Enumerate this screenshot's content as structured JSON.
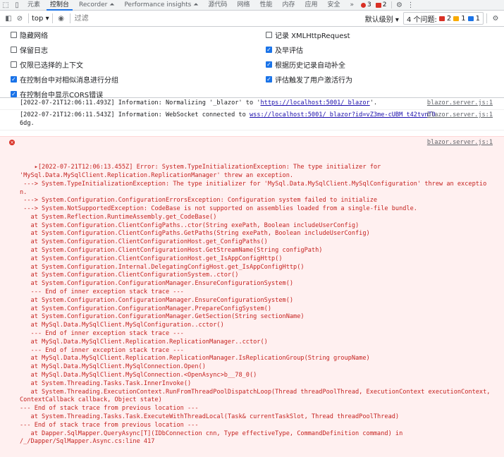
{
  "tabs": [
    "元素",
    "控制台",
    "Recorder ⏶",
    "Performance insights ⏶",
    "源代码",
    "网络",
    "性能",
    "内存",
    "应用",
    "安全"
  ],
  "active_tab_index": 1,
  "more_tabs": "»",
  "error_count": "3",
  "warning_count": "2",
  "toolbar": {
    "context": "top ▾",
    "filter_placeholder": "过滤",
    "level": "默认级别 ▾",
    "issues_label": "4 个问题:",
    "issues_errors": "2",
    "issues_warnings": "1",
    "issues_info": "1"
  },
  "settings": {
    "left": [
      {
        "label": "隐藏网络",
        "checked": false
      },
      {
        "label": "保留日志",
        "checked": false
      },
      {
        "label": "仅限已选择的上下文",
        "checked": false
      },
      {
        "label": "在控制台中对相似消息进行分组",
        "checked": true
      },
      {
        "label": "在控制台中显示CORS错误",
        "checked": true
      }
    ],
    "right": [
      {
        "label": "记录 XMLHttpRequest",
        "checked": false
      },
      {
        "label": "及早评估",
        "checked": true
      },
      {
        "label": "根据历史记录自动补全",
        "checked": true
      },
      {
        "label": "评估触发了用户激活行为",
        "checked": true
      }
    ]
  },
  "messages": [
    {
      "prefix": "[2022-07-21T12:06:11.493Z] Information: Normalizing '_blazor' to '",
      "link": "https://localhost:5001/_blazor",
      "suffix": "'.",
      "source": "blazor.server.js:1"
    },
    {
      "prefix": "[2022-07-21T12:06:11.543Z] Information: WebSocket connected to ",
      "link": "wss://localhost:5001/_blazor?id=vZ3me-cUBM_t42tvnT0",
      "suffix": "",
      "cont": "6dg.",
      "source": "blazor.server.js:1"
    }
  ],
  "error": {
    "source": "blazor.server.js:1",
    "text": "▸[2022-07-21T12:06:13.455Z] Error: System.TypeInitializationException: The type initializer for\n'MySql.Data.MySqlClient.Replication.ReplicationManager' threw an exception.\n ---> System.TypeInitializationException: The type initializer for 'MySql.Data.MySqlClient.MySqlConfiguration' threw an exception.\n ---> System.Configuration.ConfigurationErrorsException: Configuration system failed to initialize\n ---> System.NotSupportedException: CodeBase is not supported on assemblies loaded from a single-file bundle.\n   at System.Reflection.RuntimeAssembly.get_CodeBase()\n   at System.Configuration.ClientConfigPaths..ctor(String exePath, Boolean includeUserConfig)\n   at System.Configuration.ClientConfigPaths.GetPaths(String exePath, Boolean includeUserConfig)\n   at System.Configuration.ClientConfigurationHost.get_ConfigPaths()\n   at System.Configuration.ClientConfigurationHost.GetStreamName(String configPath)\n   at System.Configuration.ClientConfigurationHost.get_IsAppConfigHttp()\n   at System.Configuration.Internal.DelegatingConfigHost.get_IsAppConfigHttp()\n   at System.Configuration.ClientConfigurationSystem..ctor()\n   at System.Configuration.ConfigurationManager.EnsureConfigurationSystem()\n   --- End of inner exception stack trace ---\n   at System.Configuration.ConfigurationManager.EnsureConfigurationSystem()\n   at System.Configuration.ConfigurationManager.PrepareConfigSystem()\n   at System.Configuration.ConfigurationManager.GetSection(String sectionName)\n   at MySql.Data.MySqlClient.MySqlConfiguration..cctor()\n   --- End of inner exception stack trace ---\n   at MySql.Data.MySqlClient.Replication.ReplicationManager..cctor()\n   --- End of inner exception stack trace ---\n   at MySql.Data.MySqlClient.Replication.ReplicationManager.IsReplicationGroup(String groupName)\n   at MySql.Data.MySqlClient.MySqlConnection.Open()\n   at MySql.Data.MySqlClient.MySqlConnection.<OpenAsync>b__78_0()\n   at System.Threading.Tasks.Task.InnerInvoke()\n   at System.Threading.ExecutionContext.RunFromThreadPoolDispatchLoop(Thread threadPoolThread, ExecutionContext executionContext,\nContextCallback callback, Object state)\n--- End of stack trace from previous location ---\n   at System.Threading.Tasks.Task.ExecuteWithThreadLocal(Task& currentTaskSlot, Thread threadPoolThread)\n--- End of stack trace from previous location ---\n   at Dapper.SqlMapper.QueryAsync[T](IDbConnection cnn, Type effectiveType, CommandDefinition command) in\n/_/Dapper/SqlMapper.Async.cs:line 417"
  },
  "colors": {
    "accent": "#1a73e8",
    "error": "#d93025",
    "warning": "#f9ab00"
  }
}
